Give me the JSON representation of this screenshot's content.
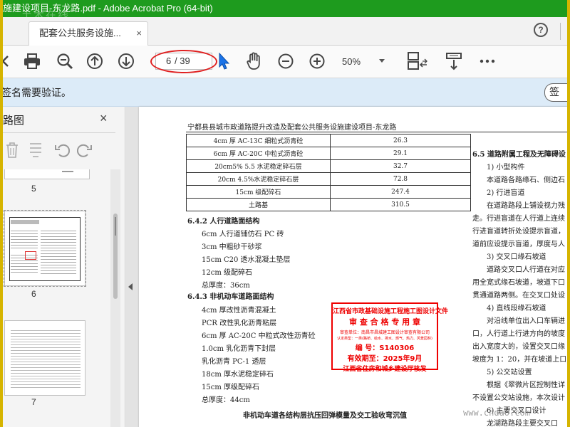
{
  "window": {
    "title": "施建设项目-东龙路.pdf - Adobe Acrobat Pro (64-bit)",
    "watermark": "土木在线"
  },
  "tabs": {
    "doc_tab_label": "配套公共服务设施...",
    "close_glyph": "×",
    "help_glyph": "?"
  },
  "toolbar": {
    "page_current": "6",
    "page_total": "/ 39",
    "zoom": "50%",
    "icons": [
      "back-icon",
      "print-icon",
      "zoom-out-magnifier-icon",
      "page-up-icon",
      "page-down-icon",
      "select-cursor-icon",
      "hand-icon",
      "zoom-minus-icon",
      "zoom-plus-icon",
      "page-view-icon",
      "scrolling-icon",
      "more-icon"
    ]
  },
  "signature_bar": {
    "message": "签名需要验证。",
    "button_label": "签"
  },
  "sidebar": {
    "title": "路图",
    "close_glyph": "×",
    "thumbnails": [
      {
        "num": "5"
      },
      {
        "num": "6"
      },
      {
        "num": "7"
      }
    ]
  },
  "document": {
    "header": "宁都县县城市政道路提升改造及配套公共服务设施建设项目-东龙路",
    "table_rows": [
      {
        "layer": "4cm 厚 AC-13C 细粒式沥青砼",
        "value": "26.3"
      },
      {
        "layer": "6cm 厚 AC-20C 中粒式沥青砼",
        "value": "29.1"
      },
      {
        "layer": "20cm5% 5.5 水泥稳定碎石层",
        "value": "32.7"
      },
      {
        "layer": "20cm 4.5%水泥稳定碎石层",
        "value": "72.8"
      },
      {
        "layer": "15cm 级配碎石",
        "value": "247.4"
      },
      {
        "layer": "土路基",
        "value": "310.5"
      }
    ],
    "left_col": [
      "6.4.2 人行道路面结构",
      "6cm 人行道铺仿石 PC 砖",
      "3cm 中粗砂干砂浆",
      "15cm C20 透水混凝土垫层",
      "12cm 级配碎石",
      "总厚度：36cm",
      "6.4.3 非机动车道路面结构",
      "4cm 厚改性沥青混凝土",
      "PCR 改性乳化沥青粘层",
      "6cm 厚 AC-20C 中粒式改性沥青砼",
      "1.0cm 乳化沥青下封层",
      "乳化沥青 PC-1 透层",
      "18cm 厚水泥稳定碎石",
      "15cm 厚级配碎石",
      "总厚度：44cm",
      "非机动车道各结构层抗压回弹模量及交工验收弯沉值"
    ],
    "right_col": [
      "6.5 道路附属工程及无障碍设",
      "1) 小型构件",
      "本道路各路缘石、侧边石",
      "2) 行进盲道",
      "在道路路段上铺设视力残",
      "走。行进盲道在人行道上连续",
      "行进盲道转折处设提示盲道，",
      "道前应设提示盲道，厚度与人",
      "3) 交叉口缘石坡道",
      "道路交叉口人行道在对应",
      "用全宽式缘石坡道，坡道下口",
      "贯通道路两侧。在交叉口处设",
      "4) 直线段缘石坡道",
      "对沿线单位出入口车辆进",
      "口，人行道上行进方向的坡度",
      "出入宽度大的，设置交叉口缘",
      "坡度为 1：20，并在坡道上口",
      "5) 公交站设置",
      "根据《翠微片区控制性详",
      "不设置公交站设施，本次设计",
      "6) 主要交叉口设计",
      "龙湖路路段主要交叉口"
    ],
    "stamp_lines": [
      "江西省市政基础设施工程施工图设计文件",
      "审 查 合 格 专 用 章",
      "审查单位：南昌市昌城建工图设计审查有限公司",
      "认定类型：一类(路桥、给水、排水、燃气、热力、风景园林)",
      "编  号：S140306",
      "有效期至：2025年9月",
      "江西省住房和城乡建设厅核发"
    ],
    "bottom_watermark": "www.cndao.com"
  }
}
